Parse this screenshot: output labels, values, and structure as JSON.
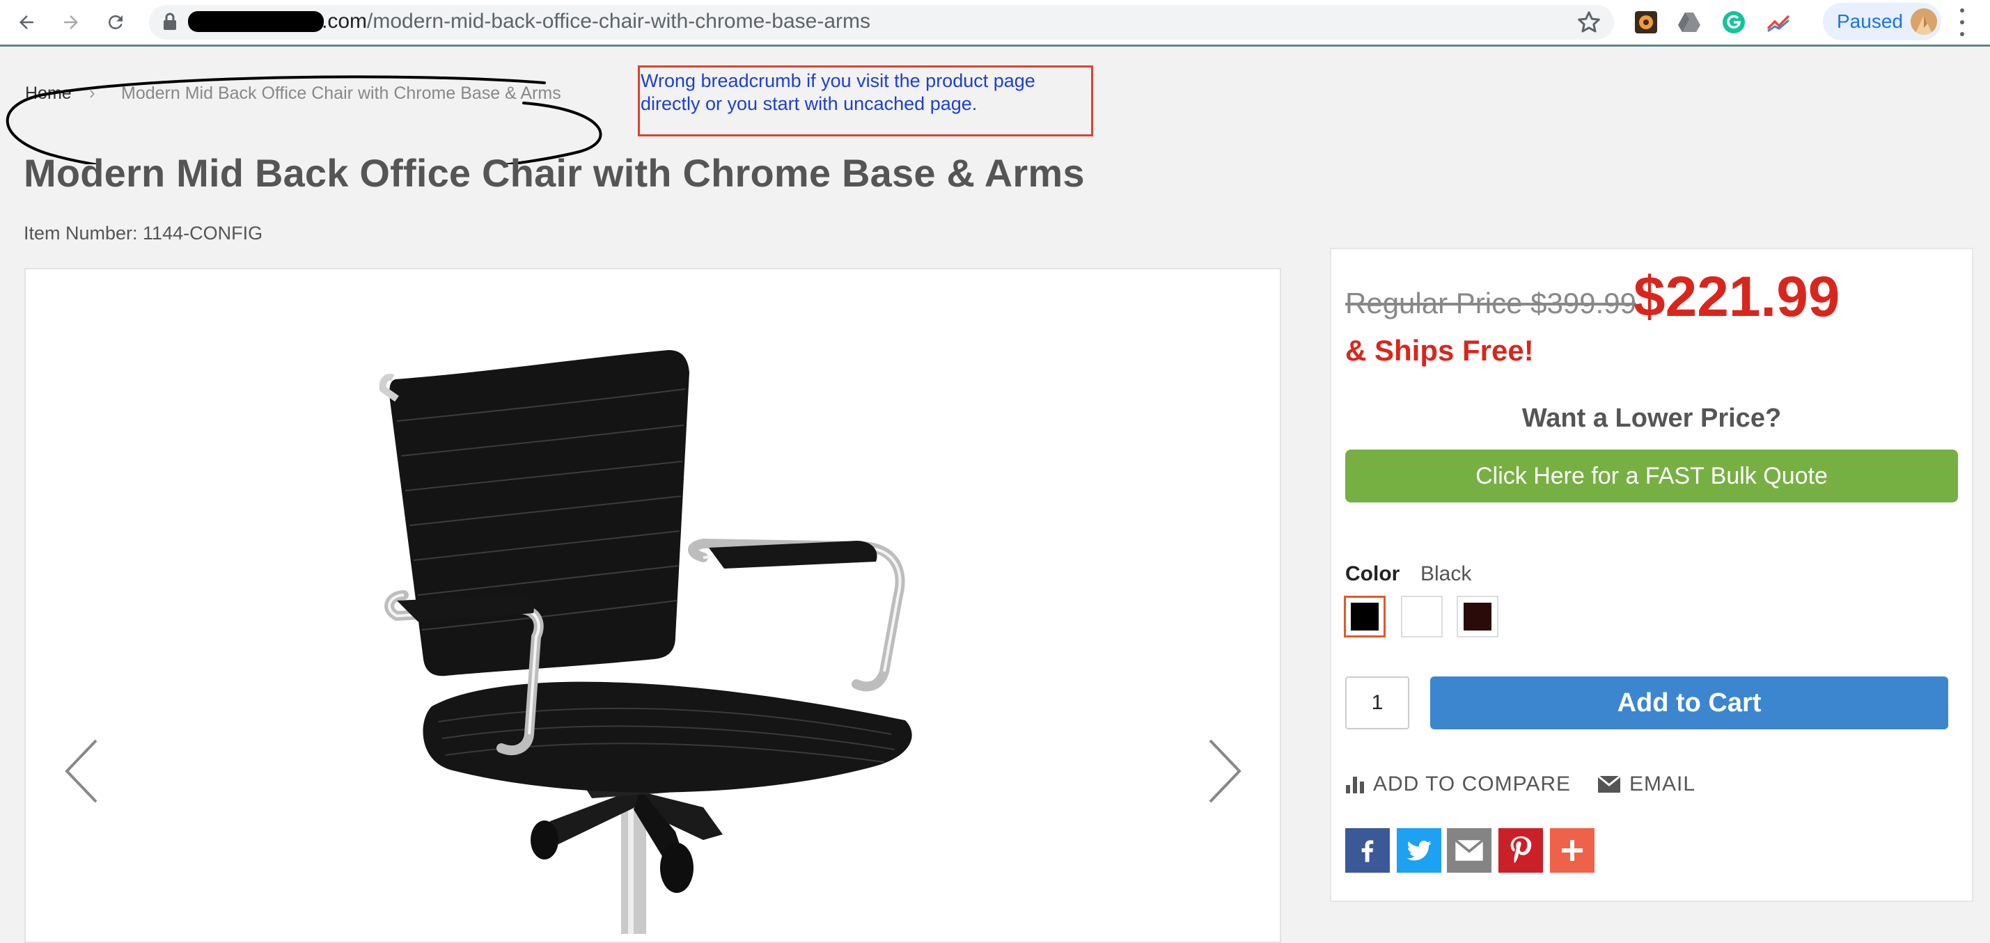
{
  "browser": {
    "url_domain_visible": ".com",
    "url_path": "/modern-mid-back-office-chair-with-chrome-base-arms",
    "profile_status": "Paused",
    "icons": [
      "back-icon",
      "forward-icon",
      "reload-icon",
      "lock-icon",
      "bookmark-star-icon",
      "extension-icon",
      "drive-icon",
      "grammarly-icon",
      "analytics-icon",
      "menu-icon"
    ]
  },
  "breadcrumb": {
    "home": "Home",
    "separator": "›",
    "current": "Modern Mid Back Office Chair with Chrome Base & Arms"
  },
  "annotation": {
    "note": "Wrong breadcrumb if you visit the product page directly or you start with uncached page."
  },
  "product": {
    "title": "Modern Mid Back Office Chair with Chrome Base & Arms",
    "item_number": "Item Number: 1144-CONFIG"
  },
  "pricing": {
    "regular_label": "Regular Price",
    "regular_price": "$399.99",
    "sale_price": "$221.99",
    "shipping": "& Ships Free!"
  },
  "quote": {
    "heading": "Want a Lower Price?",
    "button": "Click Here for a FAST Bulk Quote"
  },
  "options": {
    "color_label": "Color",
    "color_value": "Black",
    "swatches": [
      {
        "name": "Black",
        "hex": "#000000",
        "selected": true
      },
      {
        "name": "White",
        "hex": "#ffffff",
        "selected": false
      },
      {
        "name": "Burgundy",
        "hex": "#2b0a0a",
        "selected": false
      }
    ]
  },
  "cart": {
    "quantity": "1",
    "add_to_cart": "Add to Cart"
  },
  "links": {
    "compare": "ADD TO COMPARE",
    "email": "EMAIL"
  },
  "share": [
    {
      "name": "facebook",
      "color": "#3b5998"
    },
    {
      "name": "twitter",
      "color": "#1da1f2"
    },
    {
      "name": "email",
      "color": "#848484"
    },
    {
      "name": "pinterest",
      "color": "#cb2027"
    },
    {
      "name": "more",
      "color": "#f0614a"
    }
  ],
  "colors": {
    "accent_red": "#d9261c",
    "quote_green": "#76b043",
    "cart_blue": "#3b86cf",
    "annotation_red": "#d9432f",
    "annotation_text_blue": "#1d3fd1"
  }
}
